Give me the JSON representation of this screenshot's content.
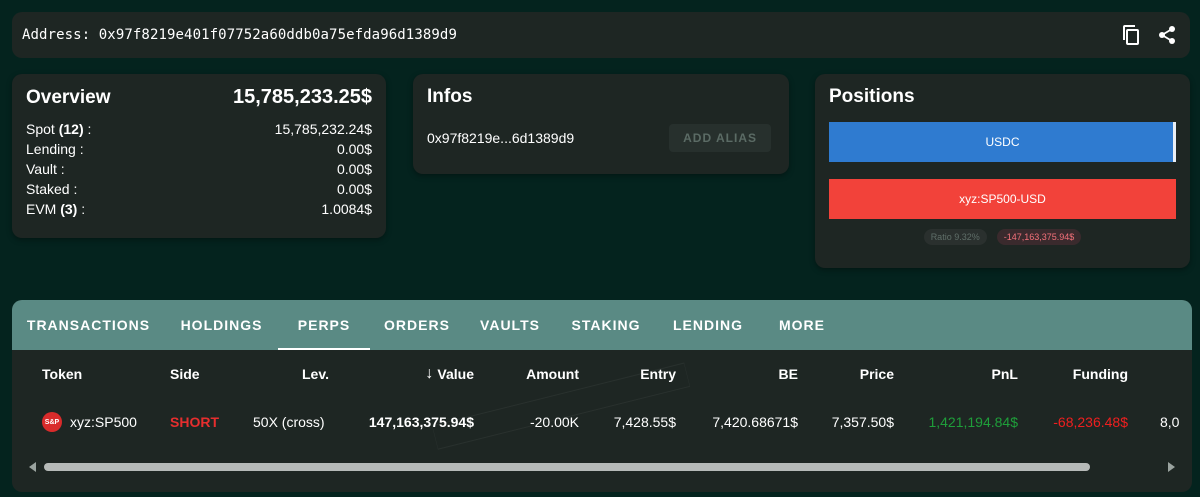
{
  "address": {
    "label": "Address:",
    "value": "0x97f8219e401f07752a60ddb0a75efda96d1389d9"
  },
  "overview": {
    "title": "Overview",
    "total": "15,785,233.25$",
    "rows": [
      {
        "label": "Spot",
        "count": "(12)",
        "suffix": " :",
        "value": "15,785,232.24$"
      },
      {
        "label": "Lending :",
        "count": "",
        "suffix": "",
        "value": "0.00$"
      },
      {
        "label": "Vault :",
        "count": "",
        "suffix": "",
        "value": "0.00$"
      },
      {
        "label": "Staked :",
        "count": "",
        "suffix": "",
        "value": "0.00$"
      },
      {
        "label": "EVM",
        "count": "(3)",
        "suffix": " :",
        "value": "1.0084$"
      }
    ]
  },
  "infos": {
    "title": "Infos",
    "short_address": "0x97f8219e...6d1389d9",
    "alias_button": "ADD ALIAS"
  },
  "positions": {
    "title": "Positions",
    "bars": [
      "USDC",
      "xyz:SP500-USD"
    ],
    "ratio": "Ratio 9.32%",
    "pnl": "-147,163,375.94$"
  },
  "tabs": [
    "TRANSACTIONS",
    "HOLDINGS",
    "PERPS",
    "ORDERS",
    "VAULTS",
    "STAKING",
    "LENDING",
    "MORE"
  ],
  "active_tab": "PERPS",
  "table": {
    "headers": {
      "token": "Token",
      "side": "Side",
      "lev": "Lev.",
      "value": "Value",
      "amount": "Amount",
      "entry": "Entry",
      "be": "BE",
      "price": "Price",
      "pnl": "PnL",
      "funding": "Funding"
    },
    "sort_arrow": "↓",
    "rows": [
      {
        "icon_text": "S&P",
        "token": "xyz:SP500",
        "side": "SHORT",
        "lev": "50X (cross)",
        "value": "147,163,375.94$",
        "amount": "-20.00K",
        "entry": "7,428.55$",
        "be": "7,420.68671$",
        "price": "7,357.50$",
        "pnl": "1,421,194.84$",
        "funding": "-68,236.48$",
        "overflow": "8,0"
      }
    ]
  },
  "colors": {
    "accent": "#5a8a84",
    "background": "#04231e",
    "card": "#1e2623",
    "short": "#e62e2e",
    "usdc": "#2f7bd0",
    "sp500": "#f2423a"
  }
}
